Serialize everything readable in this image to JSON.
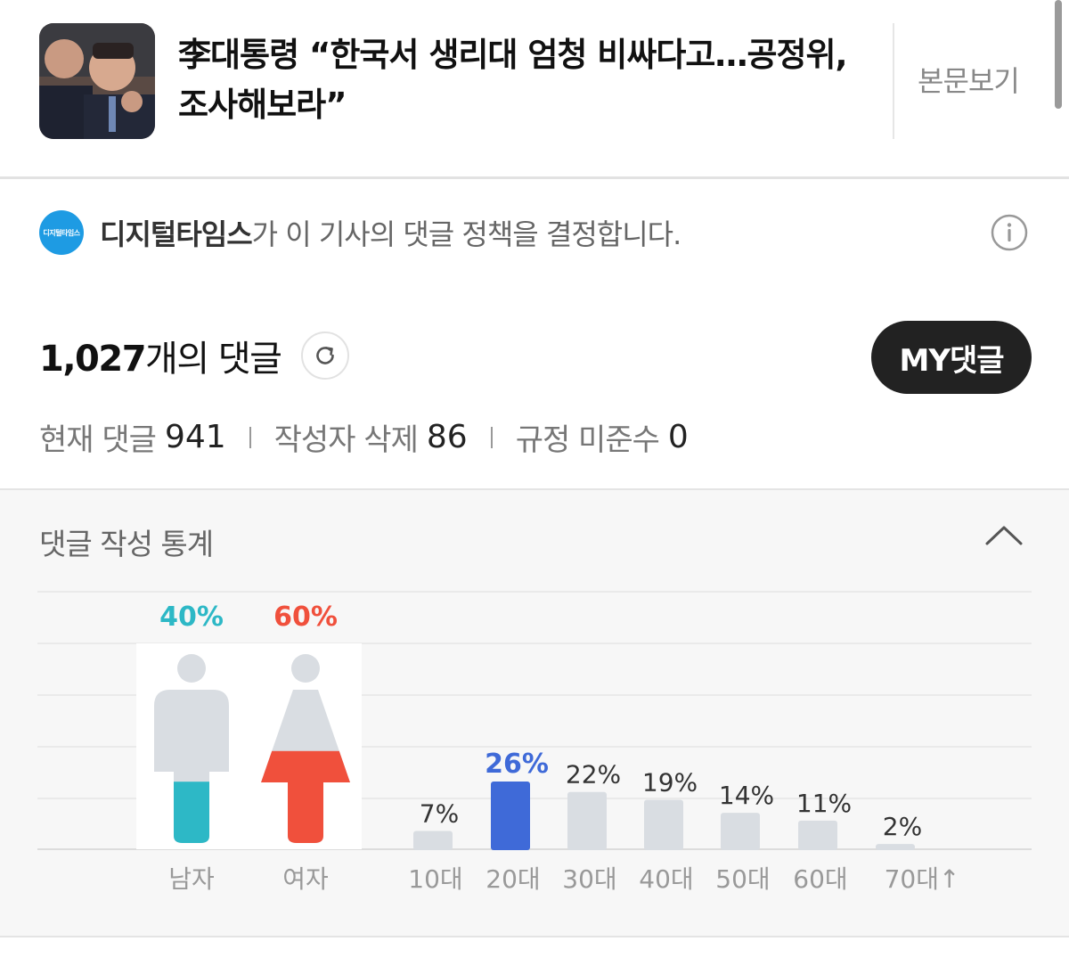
{
  "article": {
    "title": "李대통령 “한국서 생리대 엄청 비싸다고…공정위, 조사해보라”",
    "view_label": "본문보기"
  },
  "publisher": {
    "logo_text": "디지털타임스",
    "name": "디지털타임스",
    "policy_suffix": "가 이 기사의 댓글 정책을 결정합니다."
  },
  "comments": {
    "total": "1,027",
    "total_suffix": "개의 댓글",
    "my_button": "MY댓글",
    "current_label": "현재 댓글",
    "current_value": "941",
    "deleted_label": "작성자 삭제",
    "deleted_value": "86",
    "violation_label": "규정 미준수",
    "violation_value": "0"
  },
  "stats": {
    "title": "댓글 작성 통계"
  },
  "chart_data": {
    "type": "bar",
    "gender": {
      "categories": [
        "남자",
        "여자"
      ],
      "values": [
        40,
        60
      ],
      "value_labels": [
        "40%",
        "60%"
      ],
      "colors": [
        "#2db8c6",
        "#f0503c"
      ]
    },
    "age": {
      "categories": [
        "10대",
        "20대",
        "30대",
        "40대",
        "50대",
        "60대",
        "70대↑"
      ],
      "values": [
        7,
        26,
        22,
        19,
        14,
        11,
        2
      ],
      "value_labels": [
        "7%",
        "26%",
        "22%",
        "19%",
        "14%",
        "11%",
        "2%"
      ],
      "highlight_index": 1,
      "highlight_color": "#3f6ad8",
      "bar_color": "#d9dde2"
    }
  }
}
